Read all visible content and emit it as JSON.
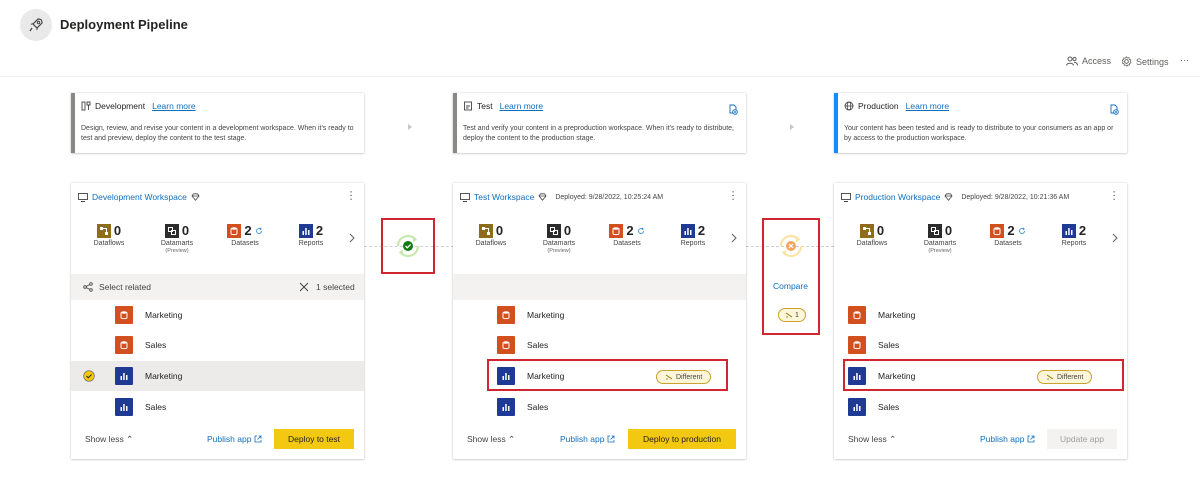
{
  "header": {
    "title": "Deployment Pipeline"
  },
  "toolbar": {
    "access_label": "Access",
    "settings_label": "Settings",
    "more_label": "···"
  },
  "stages": [
    {
      "name": "Development",
      "learn_more": "Learn more",
      "description": "Design, review, and revise your content in a development workspace. When it's ready to test and preview, deploy the content to the test stage.",
      "accent": "#8a8886"
    },
    {
      "name": "Test",
      "learn_more": "Learn more",
      "description": "Test and verify your content in a preproduction workspace. When it's ready to distribute, deploy the content to the production stage.",
      "accent": "#8a8886"
    },
    {
      "name": "Production",
      "learn_more": "Learn more",
      "description": "Your content has been tested and is ready to distribute to your consumers as an app or by access to the production workspace.",
      "accent": "#118dff"
    }
  ],
  "counts_labels": {
    "dataflows": "Dataflows",
    "datamarts": "Datamarts",
    "datamarts_sub": "(Preview)",
    "datasets": "Datasets",
    "reports": "Reports"
  },
  "workspaces": [
    {
      "name": "Development Workspace",
      "deployed": "",
      "counts": {
        "dataflows": "0",
        "datamarts": "0",
        "datasets": "2",
        "reports": "2"
      },
      "select_related": "Select related",
      "selected_count": "1 selected",
      "items": [
        {
          "type": "dataset",
          "label": "Marketing"
        },
        {
          "type": "dataset",
          "label": "Sales"
        },
        {
          "type": "report",
          "label": "Marketing"
        },
        {
          "type": "report",
          "label": "Sales"
        }
      ],
      "show_less": "Show less",
      "publish_app": "Publish app",
      "deploy_label": "Deploy to test"
    },
    {
      "name": "Test Workspace",
      "deployed": "Deployed: 9/28/2022, 10:25:24 AM",
      "counts": {
        "dataflows": "0",
        "datamarts": "0",
        "datasets": "2",
        "reports": "2"
      },
      "items": [
        {
          "type": "dataset",
          "label": "Marketing"
        },
        {
          "type": "dataset",
          "label": "Sales"
        },
        {
          "type": "report",
          "label": "Marketing",
          "badge": "Different"
        },
        {
          "type": "report",
          "label": "Sales"
        }
      ],
      "show_less": "Show less",
      "publish_app": "Publish app",
      "deploy_label": "Deploy to production"
    },
    {
      "name": "Production Workspace",
      "deployed": "Deployed: 9/28/2022, 10:21:36 AM",
      "counts": {
        "dataflows": "0",
        "datamarts": "0",
        "datasets": "2",
        "reports": "2"
      },
      "items": [
        {
          "type": "dataset",
          "label": "Marketing"
        },
        {
          "type": "dataset",
          "label": "Sales"
        },
        {
          "type": "report",
          "label": "Marketing",
          "badge": "Different"
        },
        {
          "type": "report",
          "label": "Sales"
        }
      ],
      "show_less": "Show less",
      "publish_app": "Publish app",
      "deploy_label": "Update app"
    }
  ],
  "compare": {
    "label": "Compare",
    "count": "1"
  },
  "colors": {
    "accent_blue": "#106ebe",
    "deploy_yellow": "#f2c811",
    "highlight_red": "#d0262f",
    "success_green": "#107c10",
    "warning_orange": "#f7a35c"
  }
}
